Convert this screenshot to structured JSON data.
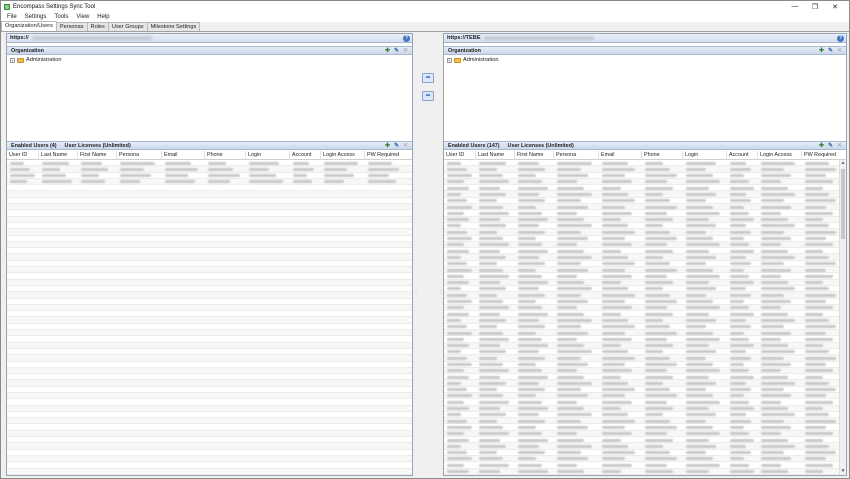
{
  "window": {
    "title": "Encompass Settings Sync Tool",
    "controls": [
      "—",
      "❐",
      "✕"
    ]
  },
  "menu": [
    "File",
    "Settings",
    "Tools",
    "View",
    "Help"
  ],
  "tabs": [
    {
      "label": "Organization/Users",
      "active": true
    },
    {
      "label": "Personas",
      "active": false
    },
    {
      "label": "Roles",
      "active": false
    },
    {
      "label": "User Groups",
      "active": false
    },
    {
      "label": "Milestone Settings",
      "active": false
    }
  ],
  "left": {
    "url": "https://",
    "org_header": "Organization",
    "tree_root": "Administration",
    "users_header": "Enabled Users (4)",
    "licenses": "User Licenses (Unlimited)",
    "row_count": 4
  },
  "right": {
    "url": "https://TEBE",
    "org_header": "Organization",
    "tree_root": "Administration",
    "users_header": "Enabled Users (147)",
    "licenses": "User Licenses (Unlimited)",
    "row_count": 147
  },
  "columns": [
    "User ID",
    "Last Name",
    "First Name",
    "Persona",
    "Email",
    "Phone",
    "Login",
    "Account",
    "Login Access",
    "PW Required"
  ],
  "icons": {
    "help": "help-icon",
    "add": "add-icon",
    "edit": "edit-icon",
    "delete": "delete-icon",
    "copy_right": "arrow-right-icon",
    "copy_left": "arrow-left-icon"
  }
}
